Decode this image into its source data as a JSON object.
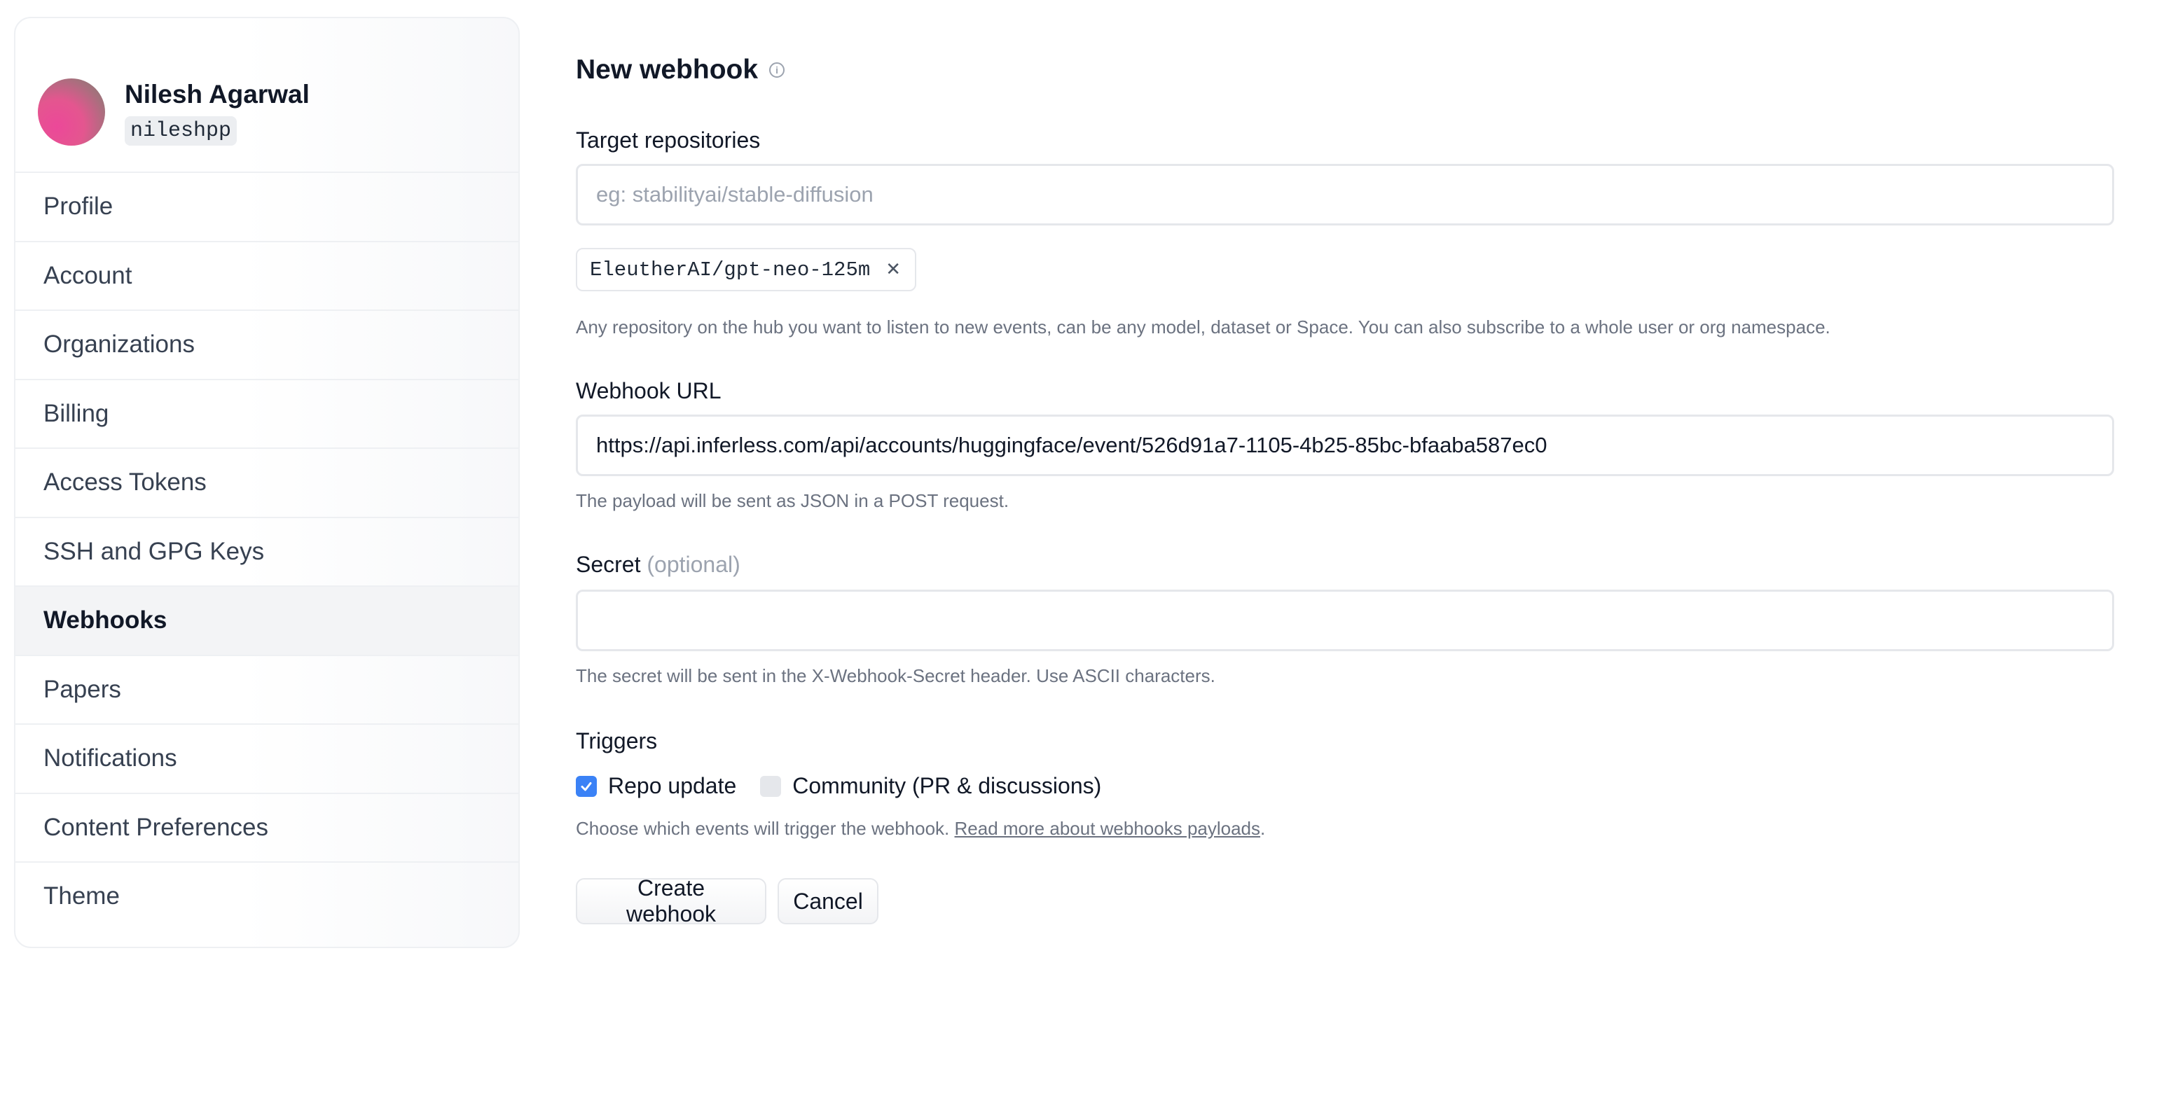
{
  "sidebar": {
    "user": {
      "name": "Nilesh Agarwal",
      "handle": "nileshpp"
    },
    "items": [
      {
        "label": "Profile"
      },
      {
        "label": "Account"
      },
      {
        "label": "Organizations"
      },
      {
        "label": "Billing"
      },
      {
        "label": "Access Tokens"
      },
      {
        "label": "SSH and GPG Keys"
      },
      {
        "label": "Webhooks",
        "active": true
      },
      {
        "label": "Papers"
      },
      {
        "label": "Notifications"
      },
      {
        "label": "Content Preferences"
      },
      {
        "label": "Theme"
      }
    ]
  },
  "form": {
    "title": "New webhook",
    "target": {
      "label": "Target repositories",
      "placeholder": "eg: stabilityai/stable-diffusion",
      "tags": [
        "EleutherAI/gpt-neo-125m"
      ],
      "help": "Any repository on the hub you want to listen to new events, can be any model, dataset or Space. You can also subscribe to a whole user or org namespace."
    },
    "url": {
      "label": "Webhook URL",
      "value": "https://api.inferless.com/api/accounts/huggingface/event/526d91a7-1105-4b25-85bc-bfaaba587ec0",
      "help": "The payload will be sent as JSON in a POST request."
    },
    "secret": {
      "label": "Secret",
      "optional": "(optional)",
      "value": "",
      "help": "The secret will be sent in the X-Webhook-Secret header. Use ASCII characters."
    },
    "triggers": {
      "label": "Triggers",
      "options": [
        {
          "label": "Repo update",
          "checked": true
        },
        {
          "label": "Community (PR & discussions)",
          "checked": false
        }
      ],
      "help": "Choose which events will trigger the webhook. ",
      "link": "Read more about webhooks payloads",
      "help_end": "."
    },
    "buttons": {
      "create": "Create webhook",
      "cancel": "Cancel"
    }
  },
  "colors": {
    "accent": "#3b82f6",
    "avatar_pink": "#ec4899"
  }
}
